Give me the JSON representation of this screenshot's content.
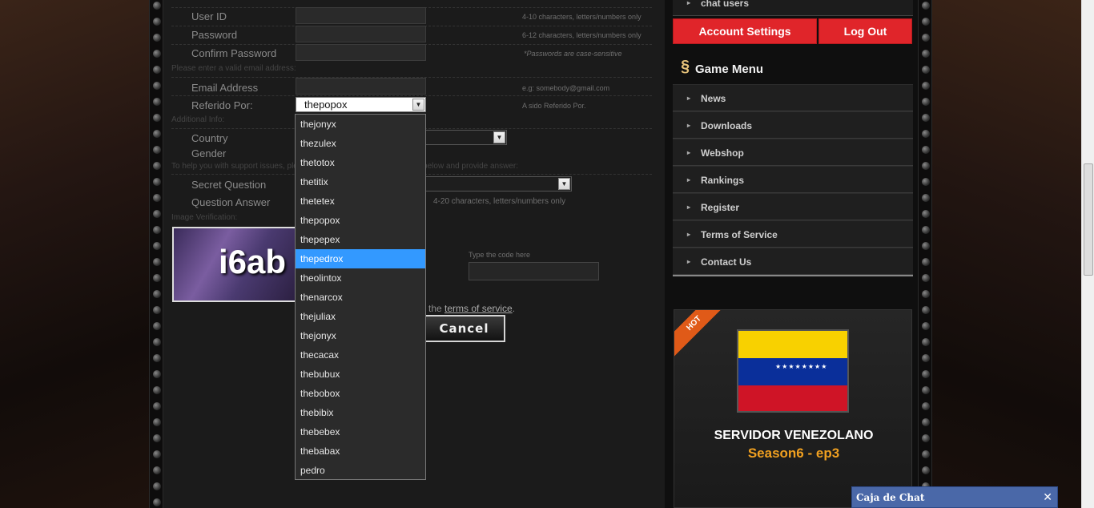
{
  "form": {
    "labels": {
      "user_id": "User ID",
      "password": "Password",
      "confirm_password": "Confirm Password",
      "email": "Email Address",
      "referido": "Referido Por:",
      "country": "Country",
      "gender": "Gender",
      "secret_question": "Secret Question",
      "question_answer": "Question Answer"
    },
    "hints": {
      "user_id": "4-10 characters, letters/numbers only",
      "password": "6-12 characters, letters/numbers only",
      "case_sensitive": "*Passwords are case-sensitive",
      "email": "e.g: somebody@gmail.com",
      "referido": "A sido Referido Por.",
      "answer": "4-20 characters, letters/numbers only",
      "code": "Type the code here"
    },
    "sections": {
      "email": "Please enter a valid email address:",
      "additional": "Additional Info:",
      "support": "To help you with support issues, please select a question from the lists below and provide answer:",
      "image": "Image Verification:"
    },
    "referido_value": "thepopox",
    "captcha_text": "i6ab",
    "terms_prefix": "the",
    "terms_link": "terms of service",
    "terms_suffix": ".",
    "cancel_label": "Cancel"
  },
  "dropdown": {
    "options": [
      "thejonyx",
      "thezulex",
      "thetotox",
      "thetitix",
      "thetetex",
      "thepopox",
      "thepepex",
      "thepedrox",
      "theolintox",
      "thenarcox",
      "thejuliax",
      "thejonyx",
      "thecacax",
      "thebubux",
      "thebobox",
      "thebibix",
      "thebebex",
      "thebabax",
      "pedro"
    ],
    "selected_index": 7
  },
  "sidebar": {
    "top_item": "chat users",
    "account_settings": "Account Settings",
    "logout": "Log Out",
    "game_menu_title": "Game Menu",
    "menu": [
      "News",
      "Downloads",
      "Webshop",
      "Rankings",
      "Register",
      "Terms of Service",
      "Contact Us"
    ],
    "promo": {
      "badge": "HOT",
      "title": "SERVIDOR VENEZOLANO",
      "subtitle": "Season6 - ep3"
    }
  },
  "chat": {
    "label": "Caja de Chat",
    "close": "✕"
  },
  "colors": {
    "accent_red": "#e0252a",
    "selected_blue": "#3399ff",
    "season_orange": "#f0a020"
  }
}
